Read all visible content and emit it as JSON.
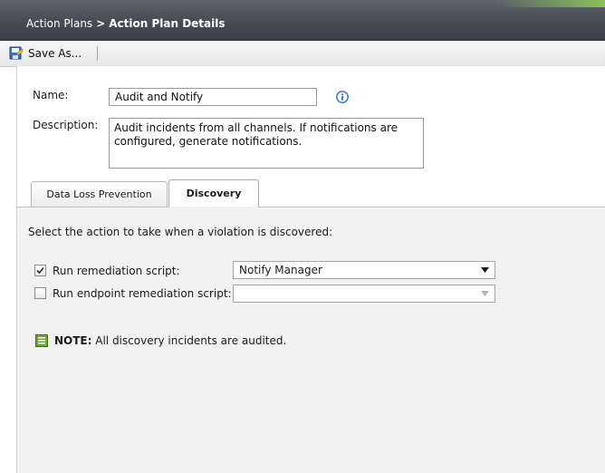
{
  "header": {
    "breadcrumb_parent": "Action Plans",
    "breadcrumb_separator": ">",
    "breadcrumb_current": "Action Plan Details"
  },
  "toolbar": {
    "save_as_label": "Save As...",
    "save_icon": "save-as-icon"
  },
  "form": {
    "name_label": "Name:",
    "name_value": "Audit and Notify",
    "info_icon": "info-icon",
    "description_label": "Description:",
    "description_value": "Audit incidents from all channels. If notifications are configured, generate notifications."
  },
  "tabs": [
    {
      "label": "Data Loss Prevention",
      "active": false
    },
    {
      "label": "Discovery",
      "active": true
    }
  ],
  "discovery": {
    "instruction": "Select the action to take when a violation is discovered:",
    "run_script": {
      "label": "Run remediation script:",
      "checked": true,
      "selected": "Notify Manager"
    },
    "run_endpoint_script": {
      "label": "Run endpoint remediation script:",
      "checked": false,
      "selected": ""
    },
    "note_prefix": "NOTE:",
    "note_text": " All discovery incidents are audited.",
    "note_icon": "note-icon"
  },
  "colors": {
    "titlebar": "#4a4f59",
    "accent_green": "#8ac35a",
    "tab_content_bg": "#f2f2f2",
    "info_blue": "#2c6fc6",
    "note_green": "#6fa534"
  }
}
